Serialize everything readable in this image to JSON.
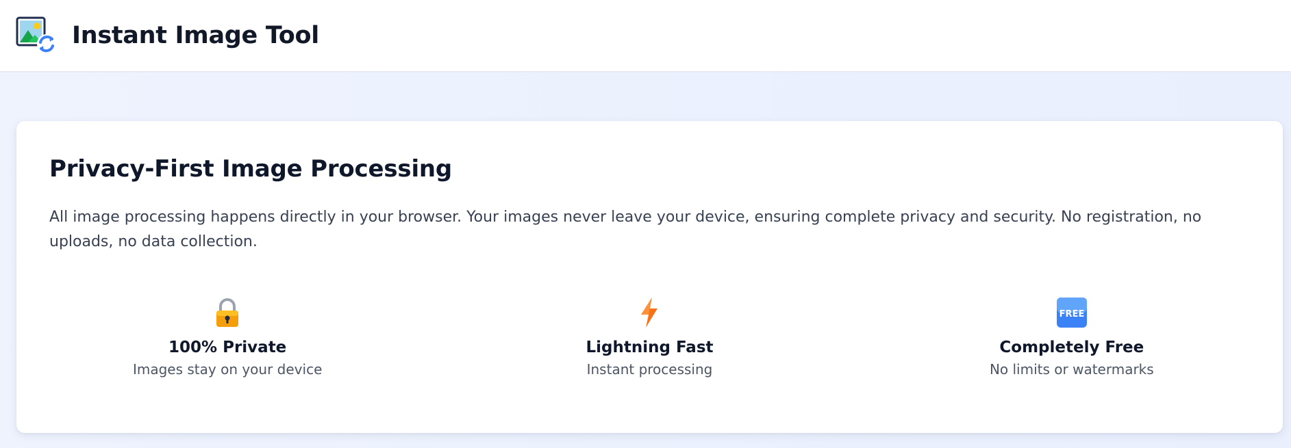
{
  "header": {
    "logo_icon": "image-convert-icon",
    "title": "Instant Image Tool"
  },
  "hero": {
    "title": "Privacy-First Image Processing",
    "description": "All image processing happens directly in your browser. Your images never leave your device, ensuring complete privacy and security. No registration, no uploads, no data collection."
  },
  "features": [
    {
      "icon": "lock-icon",
      "title": "100% Private",
      "subtitle": "Images stay on your device"
    },
    {
      "icon": "lightning-icon",
      "title": "Lightning Fast",
      "subtitle": "Instant processing"
    },
    {
      "icon": "free-badge-icon",
      "badge_text": "FREE",
      "title": "Completely Free",
      "subtitle": "No limits or watermarks"
    }
  ],
  "colors": {
    "background": "#ecf1fd",
    "card": "#ffffff",
    "text_primary": "#0f172a",
    "text_secondary": "#4b5563",
    "free_badge": "#3b82f6",
    "lock": "#f59e0b",
    "lightning": "#f97316"
  }
}
